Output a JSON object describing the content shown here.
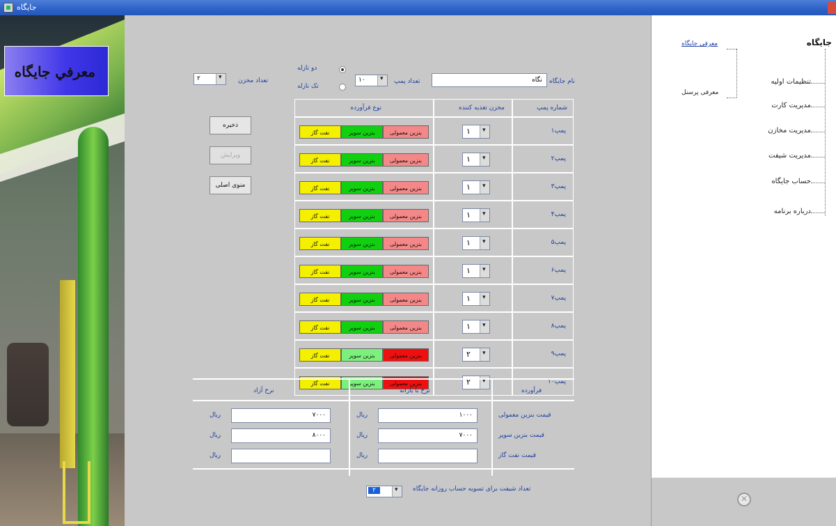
{
  "window": {
    "title": "جايگاه"
  },
  "banner": {
    "text": "معرفي جايگاه"
  },
  "form": {
    "station_name_label": "نام جايگاه",
    "station_name_value": "نگاه",
    "pump_count_label": "تعداد پمپ",
    "pump_count_value": "۱۰",
    "shift_options": [
      "دو نازله",
      "تک نازله"
    ],
    "tank_count_label": "تعداد مخزن",
    "tank_count_value": "۲",
    "grid_headers": {
      "pump_no": "شماره پمپ",
      "tank": "مخزن تغذیه کننده",
      "product": "نوع فرآورده"
    },
    "fuel_labels": {
      "regular": "بنزین معمولی",
      "super": "بنزین سوپر",
      "cng": "نفت گاز"
    },
    "rows": [
      {
        "pump": "پمپ۱",
        "tank": "۱"
      },
      {
        "pump": "پمپ۲",
        "tank": "۱"
      },
      {
        "pump": "پمپ۳",
        "tank": "۱"
      },
      {
        "pump": "پمپ۴",
        "tank": "۱"
      },
      {
        "pump": "پمپ۵",
        "tank": "۱"
      },
      {
        "pump": "پمپ۶",
        "tank": "۱"
      },
      {
        "pump": "پمپ۷",
        "tank": "۱"
      },
      {
        "pump": "پمپ۸",
        "tank": "۱"
      },
      {
        "pump": "پمپ۹",
        "tank": "۲"
      },
      {
        "pump": "پمپ۱۰",
        "tank": "۲"
      }
    ],
    "buttons": {
      "show": "ذخیره",
      "edit": "ویرایش",
      "main_menu": "منوی اصلی"
    },
    "price_headers": {
      "product": "فرآورده",
      "with_card": "نرخ با یارانه",
      "free": "نرخ آزاد"
    },
    "price_rows": [
      {
        "label": "قیمت بنزین معمولی",
        "card": "۱۰۰۰",
        "free": "۷۰۰۰"
      },
      {
        "label": "قیمت بنزین سوپر",
        "card": "۷۰۰۰",
        "free": "۸۰۰۰"
      },
      {
        "label": "قیمت نفت گاز",
        "card": "",
        "free": ""
      }
    ],
    "currency": "ریال",
    "currency_short": "ریال",
    "shift_count_label": "تعداد شیفت برای تسویه حساب روزانه جایگاه",
    "shift_count_value": "۲"
  },
  "nav": {
    "title": "جایگاه",
    "items": [
      "تنظیمات اولیه",
      "مدیریت کارت",
      "مدیریت مخازن",
      "مدیریت شیفت",
      "حساب جایگاه",
      "درباره برنامه"
    ],
    "sub_items": [
      "معرفی جایگاه",
      "معرفی پرسنل"
    ]
  },
  "colors": {
    "titlebar": "#2f63c8",
    "yellow": "#f4f000",
    "green": "#10d010",
    "pink": "#f48888",
    "red": "#ee1010"
  }
}
